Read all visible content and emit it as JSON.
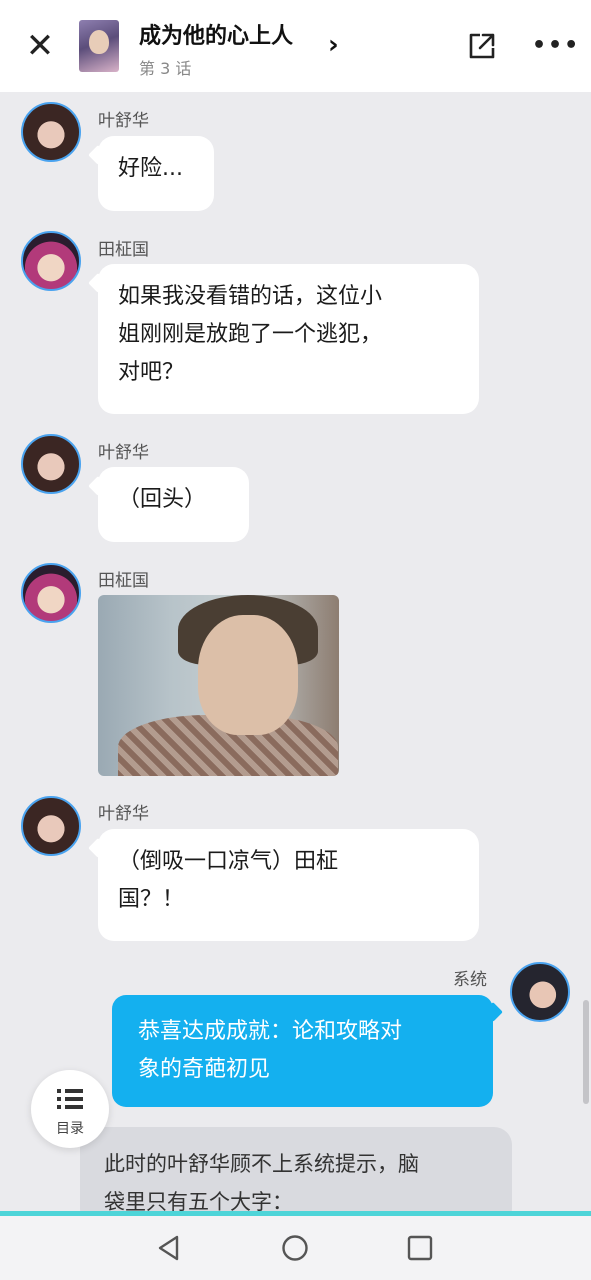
{
  "header": {
    "title": "成为他的心上人",
    "episode": "第 3 话",
    "close_icon": "close-icon",
    "share_icon": "share-icon",
    "more_icon": "more-icon"
  },
  "messages": [
    {
      "speaker": "叶舒华",
      "lines": [
        "好险..."
      ]
    },
    {
      "speaker": "田柾国",
      "lines": [
        "如果我没看错的话，这位小",
        "姐刚刚是放跑了一个逃犯，",
        "对吧？"
      ]
    },
    {
      "speaker": "叶舒华",
      "lines": [
        "（回头）"
      ]
    },
    {
      "speaker": "田柾国",
      "image": "photo"
    },
    {
      "speaker": "叶舒华",
      "lines": [
        "（倒吸一口凉气）田柾",
        "国？！"
      ]
    }
  ],
  "system": {
    "speaker": "系统",
    "lines": [
      "恭喜达成成就：论和攻略对",
      "象的奇葩初见"
    ]
  },
  "narration": {
    "lines": [
      "此时的叶舒华顾不上系统提示，脑",
      "袋里只有五个大字："
    ]
  },
  "toc": {
    "label": "目录"
  },
  "colors": {
    "accent_blue": "#14b0ef",
    "avatar_ring": "#4aa3ef",
    "nav_accent": "#4dd4d8"
  }
}
